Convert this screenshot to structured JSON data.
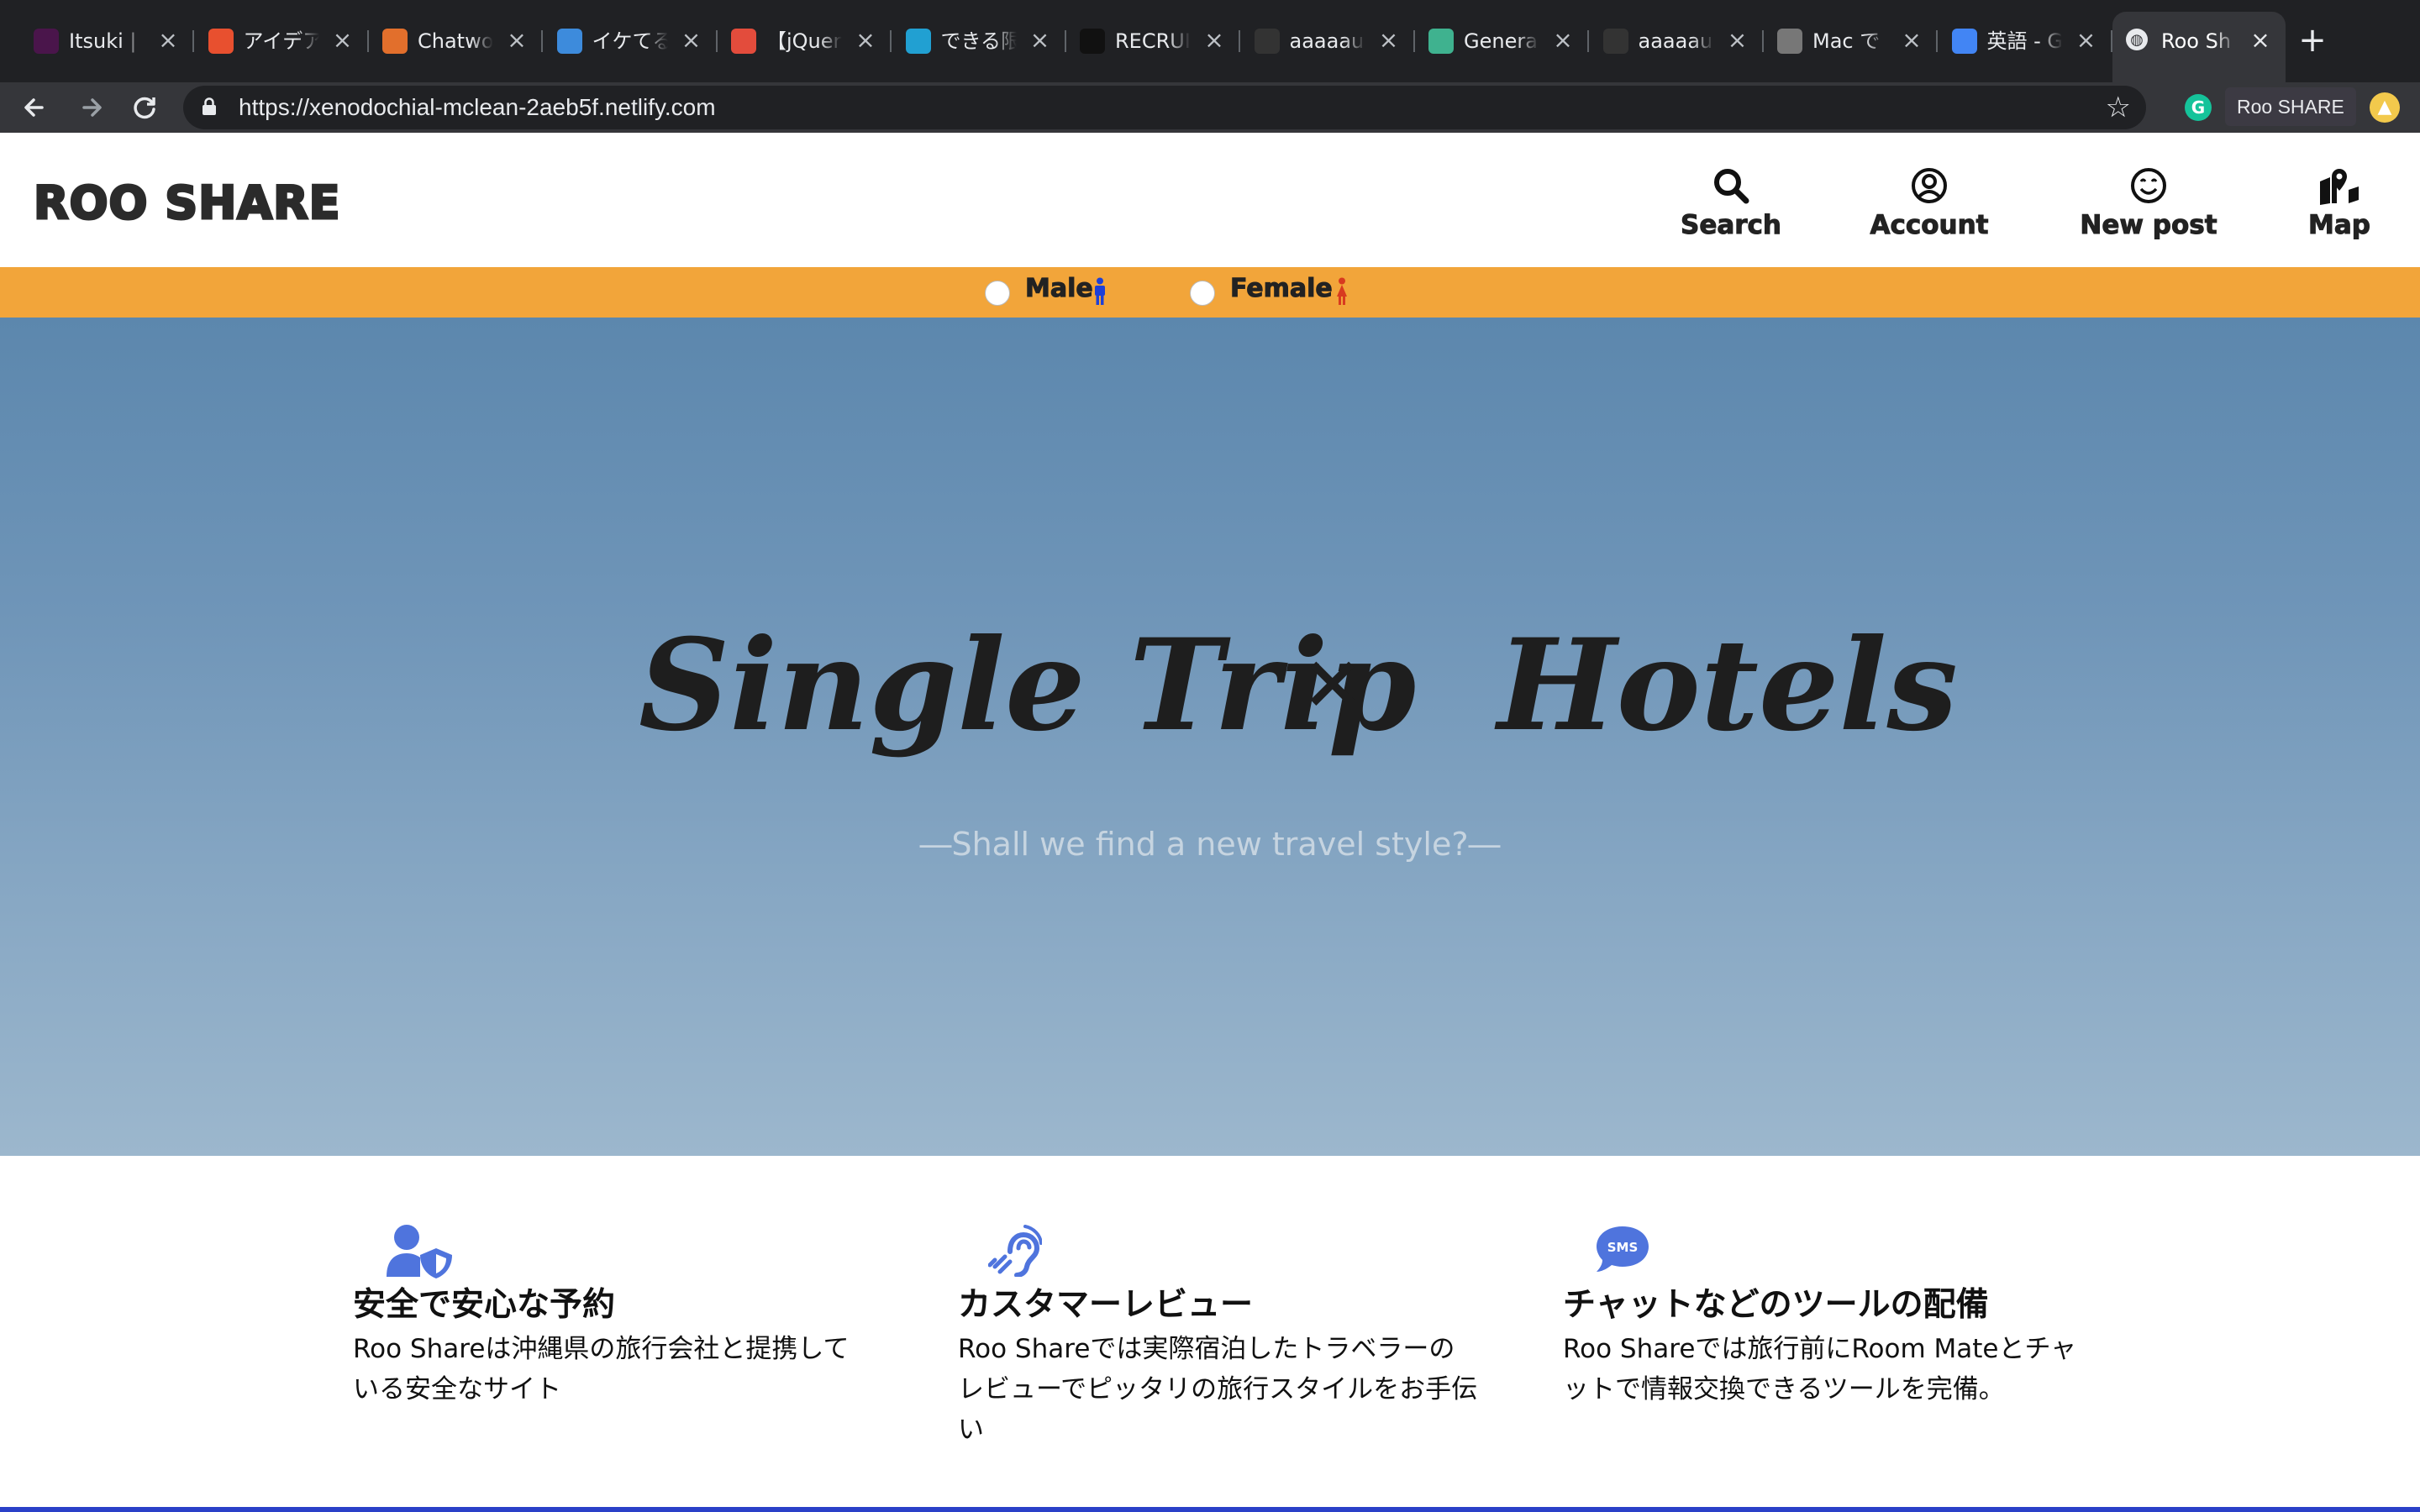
{
  "browser": {
    "tabs": [
      {
        "title": "Itsuki |",
        "icon": "slack-icon",
        "color": "#4a154b"
      },
      {
        "title": "アイデア",
        "icon": "flame-icon",
        "color": "#e8502f"
      },
      {
        "title": "Chatwork",
        "icon": "chatwork-icon",
        "color": "#e26f2c"
      },
      {
        "title": "イケてる",
        "icon": "chart-icon",
        "color": "#3d8bdc"
      },
      {
        "title": "【jQuery",
        "icon": "circle-icon",
        "color": "#e34c3c"
      },
      {
        "title": "できる限",
        "icon": "w-icon",
        "color": "#21a0d2"
      },
      {
        "title": "RECRUIT",
        "icon": "book-icon",
        "color": "#111111"
      },
      {
        "title": "aaaaau",
        "icon": "github-icon",
        "color": "#333333"
      },
      {
        "title": "Genera",
        "icon": "diamond-icon",
        "color": "#3fb28f"
      },
      {
        "title": "aaaaau",
        "icon": "github-icon",
        "color": "#333333"
      },
      {
        "title": "Mac で",
        "icon": "apple-icon",
        "color": "#777777"
      },
      {
        "title": "英語 - G",
        "icon": "google-icon",
        "color": "#4285f4"
      },
      {
        "title": "Roo Sh",
        "icon": "globe-icon",
        "color": "#e8eaed",
        "active": true
      }
    ],
    "url": "https://xenodochial-mclean-2aeb5f.netlify.com",
    "extension_tooltip": "Roo SHARE"
  },
  "header": {
    "logo": "ROO SHARE",
    "nav": [
      {
        "label": "Search",
        "icon": "search-icon"
      },
      {
        "label": "Account",
        "icon": "account-icon"
      },
      {
        "label": "New post",
        "icon": "smile-icon"
      },
      {
        "label": "Map",
        "icon": "map-icon"
      }
    ]
  },
  "gender": {
    "male_label": "Male",
    "female_label": "Female",
    "male_color": "#1e40d6",
    "female_color": "#d83a1f"
  },
  "hero": {
    "title_left": "Single Trip",
    "title_mid": "×",
    "title_right": "Hotels",
    "subtitle": "―Shall we find a new travel style?―"
  },
  "features": [
    {
      "icon": "user-shield-icon",
      "title": "安全で安心な予約",
      "text": "Roo Shareは沖縄県の旅行会社と提携している安全なサイト"
    },
    {
      "icon": "assistive-listening-icon",
      "title": "カスタマーレビュー",
      "text": "Roo Shareでは実際宿泊したトラベラーのレビューでピッタリの旅行スタイルをお手伝い"
    },
    {
      "icon": "sms-icon",
      "title": "チャットなどのツールの配備",
      "text": "Roo Shareでは旅行前にRoom Mateとチャットで情報交換できるツールを完備。"
    }
  ],
  "accent_color": "#4f74dd"
}
